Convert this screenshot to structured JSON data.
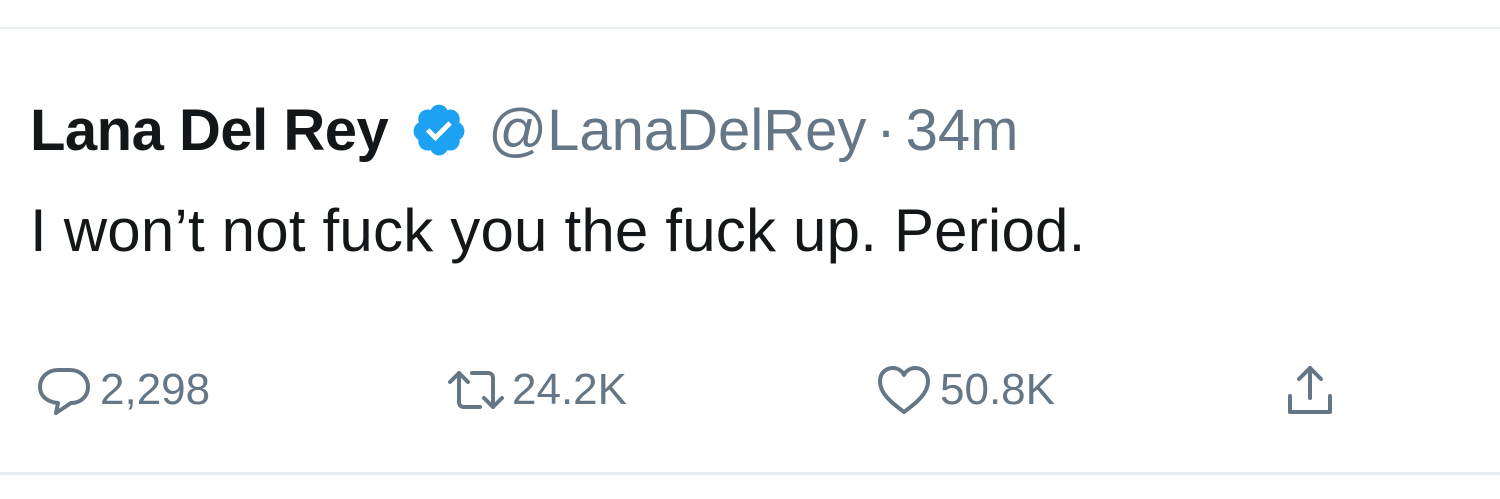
{
  "tweet": {
    "author_name": "Lana Del Rey",
    "verified": true,
    "handle": "@LanaDelRey",
    "separator": "·",
    "timestamp": "34m",
    "text": "I won’t not fuck you the fuck up. Period.",
    "actions": {
      "reply": {
        "icon": "reply-icon",
        "count": "2,298"
      },
      "retweet": {
        "icon": "retweet-icon",
        "count": "24.2K"
      },
      "like": {
        "icon": "heart-icon",
        "count": "50.8K"
      },
      "share": {
        "icon": "share-icon"
      }
    }
  },
  "colors": {
    "text_primary": "#14171a",
    "text_secondary": "#657786",
    "verified_blue": "#1da1f2",
    "divider": "#e6ecf0"
  }
}
